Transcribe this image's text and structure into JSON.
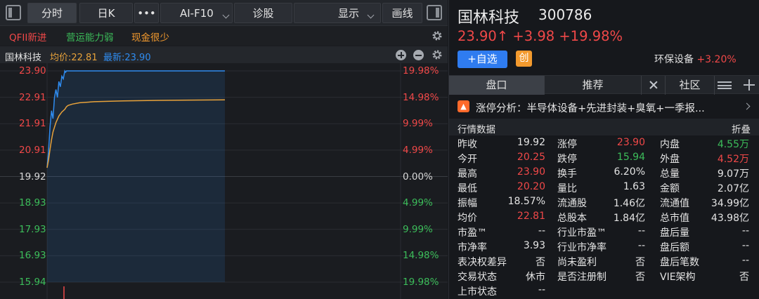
{
  "toolbar": {
    "tabs": [
      "分时",
      "日K",
      "•••",
      "AI-F10",
      "诊股",
      "显示",
      "画线"
    ]
  },
  "tags": {
    "qfii": "QFII新进",
    "operation": "营运能力弱",
    "cash": "现金很少"
  },
  "infobar": {
    "name": "国林科技",
    "avg": "均价:22.81",
    "latest": "最新:23.90"
  },
  "chart_data": {
    "type": "line",
    "y_labels": [
      "23.90",
      "22.91",
      "21.91",
      "20.91",
      "19.92",
      "18.93",
      "17.93",
      "16.93",
      "15.94"
    ],
    "pct_labels": [
      "19.98%",
      "14.98%",
      "9.99%",
      "4.99%",
      "0.00%",
      "4.99%",
      "9.99%",
      "14.98%",
      "19.98%"
    ],
    "ylim": [
      15.94,
      23.9
    ],
    "prev_close": 19.92,
    "series": [
      {
        "name": "最新",
        "color": "#2f8cf0",
        "x": [
          0,
          1,
          2,
          3,
          4,
          5,
          6,
          7,
          8,
          9,
          10,
          11,
          12,
          14,
          16,
          20,
          25,
          30,
          240
        ],
        "values": [
          20.25,
          20.9,
          21.8,
          22.4,
          22.1,
          22.9,
          23.2,
          22.9,
          23.5,
          23.3,
          23.7,
          23.6,
          23.9,
          23.85,
          23.9,
          23.9,
          23.9,
          23.9,
          23.9
        ]
      },
      {
        "name": "均价",
        "color": "#e8a23a",
        "x": [
          0,
          1,
          2,
          3,
          4,
          6,
          8,
          10,
          12,
          16,
          20,
          30,
          40,
          60,
          100,
          150,
          240
        ],
        "values": [
          20.25,
          20.55,
          20.95,
          21.3,
          21.6,
          21.95,
          22.2,
          22.35,
          22.45,
          22.55,
          22.6,
          22.65,
          22.7,
          22.74,
          22.77,
          22.79,
          22.81
        ]
      }
    ],
    "x_max": 240,
    "visible_until": 240
  },
  "stock": {
    "name": "国林科技",
    "code": "300786",
    "price": "23.90",
    "arrow": "↑",
    "change": "+3.98",
    "change_pct": "+19.98%",
    "fav_label": "+自选",
    "board_badge": "创",
    "sector_name": "环保设备",
    "sector_pct": "+3.20%"
  },
  "right_tabs": {
    "pankou": "盘口",
    "recommend": "推荐",
    "community": "社区"
  },
  "limit_analysis": {
    "icon": "fire-icon",
    "text": "涨停分析：半导体设备+先进封装+臭氧+一季报..."
  },
  "section": {
    "title": "行情数据",
    "collapse": "折叠"
  },
  "quote": [
    [
      {
        "l": "昨收",
        "v": "19.92",
        "c": ""
      },
      {
        "l": "涨停",
        "v": "23.90",
        "c": "red"
      },
      {
        "l": "内盘",
        "v": "4.55万",
        "c": "green"
      }
    ],
    [
      {
        "l": "今开",
        "v": "20.25",
        "c": "red"
      },
      {
        "l": "跌停",
        "v": "15.94",
        "c": "green"
      },
      {
        "l": "外盘",
        "v": "4.52万",
        "c": "red"
      }
    ],
    [
      {
        "l": "最高",
        "v": "23.90",
        "c": "red"
      },
      {
        "l": "换手",
        "v": "6.20%",
        "c": ""
      },
      {
        "l": "总量",
        "v": "9.07万",
        "c": ""
      }
    ],
    [
      {
        "l": "最低",
        "v": "20.20",
        "c": "red"
      },
      {
        "l": "量比",
        "v": "1.63",
        "c": ""
      },
      {
        "l": "金额",
        "v": "2.07亿",
        "c": ""
      }
    ],
    [
      {
        "l": "振幅",
        "v": "18.57%",
        "c": ""
      },
      {
        "l": "流通股",
        "v": "1.46亿",
        "c": ""
      },
      {
        "l": "流通值",
        "v": "34.99亿",
        "c": ""
      }
    ],
    [
      {
        "l": "均价",
        "v": "22.81",
        "c": "red"
      },
      {
        "l": "总股本",
        "v": "1.84亿",
        "c": ""
      },
      {
        "l": "总市值",
        "v": "43.98亿",
        "c": ""
      }
    ],
    [
      {
        "l": "市盈™",
        "v": "--",
        "c": ""
      },
      {
        "l": "行业市盈™",
        "v": "--",
        "c": ""
      },
      {
        "l": "盘后量",
        "v": "--",
        "c": ""
      }
    ],
    [
      {
        "l": "市净率",
        "v": "3.93",
        "c": ""
      },
      {
        "l": "行业市净率",
        "v": "--",
        "c": ""
      },
      {
        "l": "盘后额",
        "v": "--",
        "c": ""
      }
    ],
    [
      {
        "l": "表决权差异",
        "v": "否",
        "c": ""
      },
      {
        "l": "尚未盈利",
        "v": "否",
        "c": ""
      },
      {
        "l": "盘后笔数",
        "v": "--",
        "c": ""
      }
    ],
    [
      {
        "l": "交易状态",
        "v": "休市",
        "c": ""
      },
      {
        "l": "是否注册制",
        "v": "否",
        "c": ""
      },
      {
        "l": "VIE架构",
        "v": "否",
        "c": ""
      }
    ],
    [
      {
        "l": "上市状态",
        "v": "--",
        "c": ""
      }
    ]
  ]
}
